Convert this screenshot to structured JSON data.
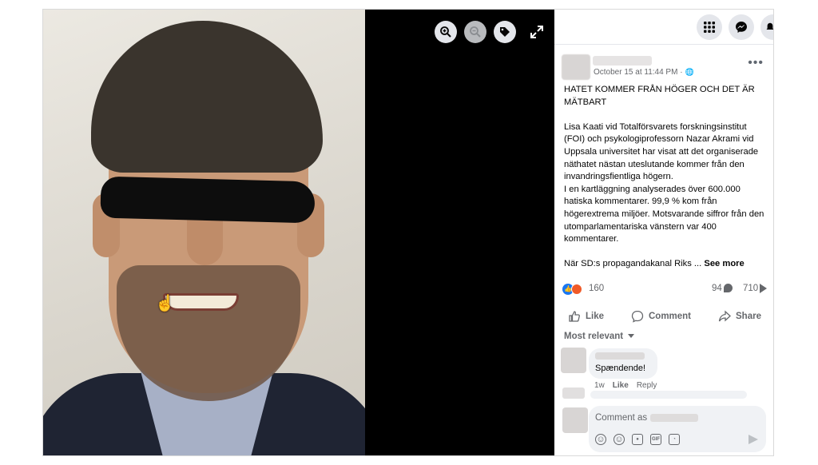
{
  "viewer": {
    "tools": [
      {
        "icon": "zoom-in-icon",
        "enabled": true
      },
      {
        "icon": "zoom-out-icon",
        "enabled": false
      },
      {
        "icon": "tag-icon",
        "enabled": true
      }
    ],
    "expand_icon": "expand-icon"
  },
  "topbar": {
    "buttons": [
      "menu-grid-icon",
      "messenger-icon",
      "notifications-icon"
    ]
  },
  "post": {
    "timestamp": "October 15 at 11:44 PM · ",
    "audience_icon": "globe-icon",
    "more": "•••",
    "title": "HATET KOMMER FRÅN HÖGER OCH DET ÄR MÄTBART",
    "body": "Lisa Kaati vid Totalförsvarets forskningsinstitut (FOI) och psykologiprofessorn Nazar Akrami vid Uppsala universitet har visat att det organiserade näthatet nästan uteslutande kommer från den invandringsfientliga högern.\nI en kartläggning analyserades över 600.000 hatiska kommentarer. 99,9 % kom från högerextrema miljöer. Motsvarande siffror från den utomparlamentariska vänstern var 400 kommentarer.\n\nNär SD:s propagandakanal Riks ... ",
    "see_more": "See more",
    "reaction_count": "160",
    "comment_count": "94",
    "share_count": "710"
  },
  "actions": {
    "like": "Like",
    "comment": "Comment",
    "share": "Share"
  },
  "sort_label": "Most relevant",
  "comments": [
    {
      "text": "Spændende!",
      "age": "1w",
      "like": "Like",
      "reply": "Reply"
    }
  ],
  "composer": {
    "placeholder": "Comment as",
    "icons": [
      "avatar-sticker-icon",
      "emoji-icon",
      "camera-icon",
      "gif-icon",
      "sticker-icon"
    ],
    "gif_label": "GIF"
  },
  "colors": {
    "accent": "#1877f2",
    "angry": "#f05a28",
    "muted": "#65676b",
    "surface": "#f0f2f5"
  }
}
